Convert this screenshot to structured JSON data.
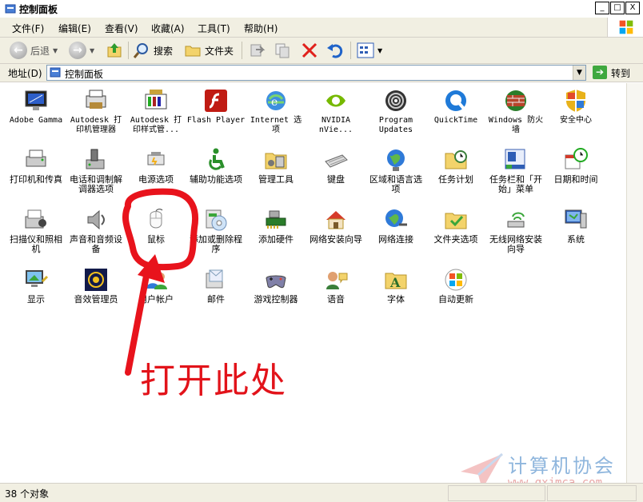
{
  "window": {
    "title": "控制面板",
    "min": "_",
    "max": "□",
    "close": "X"
  },
  "menu": [
    "文件(F)",
    "编辑(E)",
    "查看(V)",
    "收藏(A)",
    "工具(T)",
    "帮助(H)"
  ],
  "toolbar": {
    "back": "后退",
    "search": "搜索",
    "folders": "文件夹"
  },
  "address": {
    "label": "地址(D)",
    "value": "控制面板",
    "go": "转到"
  },
  "items": [
    {
      "label": "Adobe Gamma",
      "icon": "adobe-gamma-icon"
    },
    {
      "label": "Autodesk 打印机管理器",
      "icon": "autodesk-printer-manager-icon"
    },
    {
      "label": "Autodesk 打印样式管...",
      "icon": "autodesk-plot-style-icon"
    },
    {
      "label": "Flash Player",
      "icon": "flash-player-icon"
    },
    {
      "label": "Internet 选项",
      "icon": "internet-options-icon"
    },
    {
      "label": "NVIDIA nVie...",
      "icon": "nvidia-icon"
    },
    {
      "label": "Program Updates",
      "icon": "program-updates-icon"
    },
    {
      "label": "QuickTime",
      "icon": "quicktime-icon"
    },
    {
      "label": "Windows 防火墙",
      "icon": "firewall-icon"
    },
    {
      "label": "安全中心",
      "icon": "security-center-icon"
    },
    {
      "label": "打印机和传真",
      "icon": "printer-fax-icon"
    },
    {
      "label": "电话和调制解调器选项",
      "icon": "phone-modem-icon"
    },
    {
      "label": "电源选项",
      "icon": "power-options-icon"
    },
    {
      "label": "辅助功能选项",
      "icon": "accessibility-icon"
    },
    {
      "label": "管理工具",
      "icon": "admin-tools-icon"
    },
    {
      "label": "键盘",
      "icon": "keyboard-icon"
    },
    {
      "label": "区域和语言选项",
      "icon": "region-language-icon"
    },
    {
      "label": "任务计划",
      "icon": "scheduled-tasks-icon"
    },
    {
      "label": "任务栏和「开始」菜单",
      "icon": "taskbar-start-menu-icon"
    },
    {
      "label": "日期和时间",
      "icon": "date-time-icon"
    },
    {
      "label": "扫描仪和照相机",
      "icon": "scanner-camera-icon"
    },
    {
      "label": "声音和音频设备",
      "icon": "sound-audio-icon"
    },
    {
      "label": "鼠标",
      "icon": "mouse-icon"
    },
    {
      "label": "添加或删除程序",
      "icon": "add-remove-programs-icon"
    },
    {
      "label": "添加硬件",
      "icon": "add-hardware-icon"
    },
    {
      "label": "网络安装向导",
      "icon": "network-setup-wizard-icon"
    },
    {
      "label": "网络连接",
      "icon": "network-connections-icon"
    },
    {
      "label": "文件夹选项",
      "icon": "folder-options-icon"
    },
    {
      "label": "无线网络安装向导",
      "icon": "wireless-wizard-icon"
    },
    {
      "label": "系统",
      "icon": "system-icon"
    },
    {
      "label": "显示",
      "icon": "display-icon"
    },
    {
      "label": "音效管理员",
      "icon": "sound-manager-icon"
    },
    {
      "label": "用户帐户",
      "icon": "user-accounts-icon"
    },
    {
      "label": "邮件",
      "icon": "mail-icon"
    },
    {
      "label": "游戏控制器",
      "icon": "game-controller-icon"
    },
    {
      "label": "语音",
      "icon": "speech-icon"
    },
    {
      "label": "字体",
      "icon": "fonts-icon"
    },
    {
      "label": "自动更新",
      "icon": "automatic-updates-icon"
    }
  ],
  "annotation": {
    "text": "打开此处",
    "color": "#e2131a"
  },
  "status": {
    "text": "38 个对象"
  },
  "watermark": {
    "line1": "计算机协会",
    "line2": "www.gxjmca.com"
  }
}
